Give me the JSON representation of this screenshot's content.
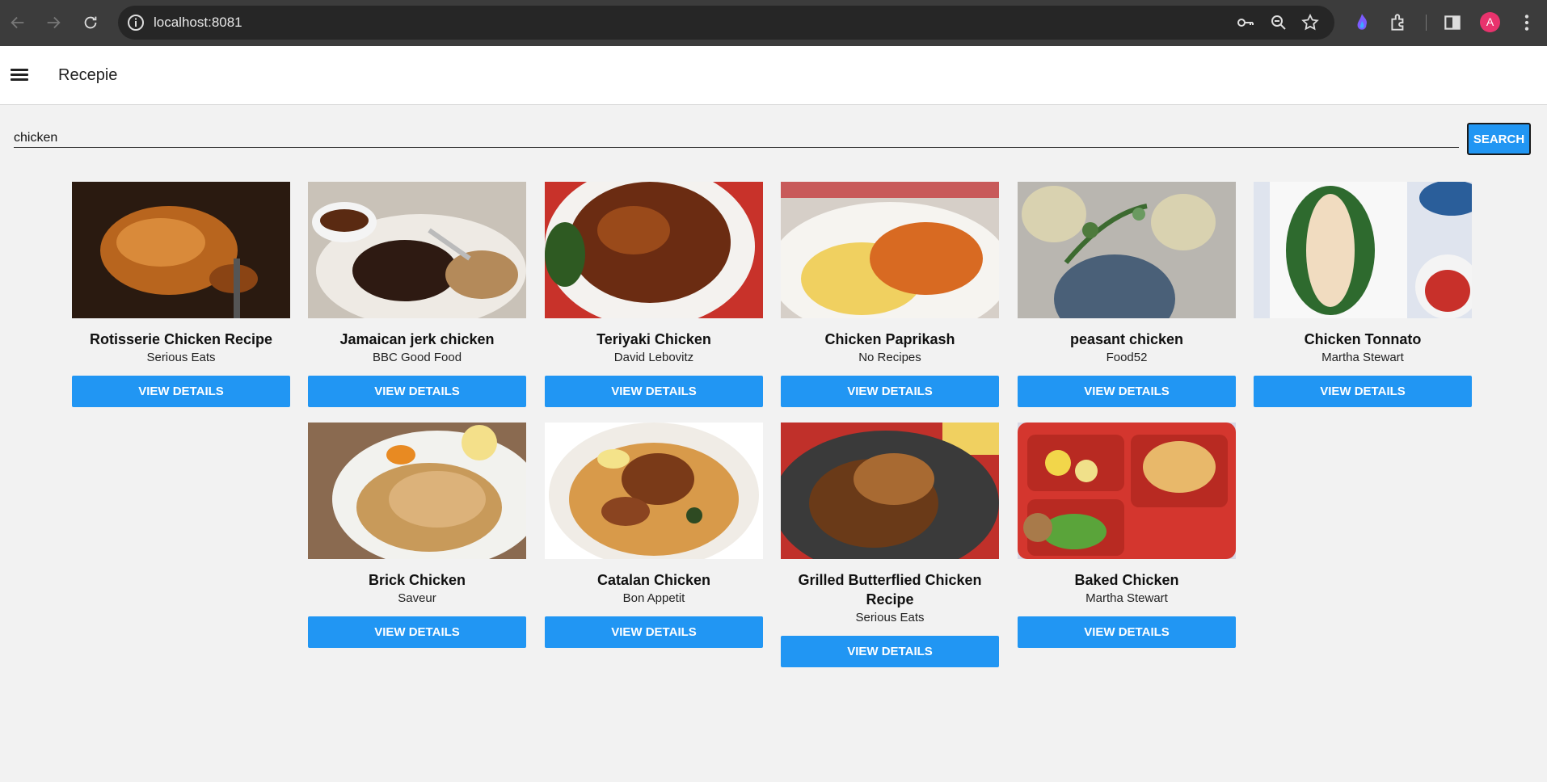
{
  "browser": {
    "url": "localhost:8081",
    "profile_initial": "A",
    "icons": [
      "back-icon",
      "forward-icon",
      "reload-icon",
      "site-info-icon",
      "password-key-icon",
      "zoom-icon",
      "bookmark-star-icon",
      "extension-icon",
      "puzzle-extensions-icon",
      "side-panel-icon",
      "more-menu-icon"
    ]
  },
  "app": {
    "title": "Recepie",
    "menu_icon": "hamburger-menu-icon"
  },
  "search": {
    "value": "chicken",
    "button_label": "SEARCH"
  },
  "recipes": [
    {
      "title": "Rotisserie Chicken Recipe",
      "source": "Serious Eats",
      "button": "VIEW DETAILS"
    },
    {
      "title": "Jamaican jerk chicken",
      "source": "BBC Good Food",
      "button": "VIEW DETAILS"
    },
    {
      "title": "Teriyaki Chicken",
      "source": "David Lebovitz",
      "button": "VIEW DETAILS"
    },
    {
      "title": "Chicken Paprikash",
      "source": "No Recipes",
      "button": "VIEW DETAILS"
    },
    {
      "title": "peasant chicken",
      "source": "Food52",
      "button": "VIEW DETAILS"
    },
    {
      "title": "Chicken Tonnato",
      "source": "Martha Stewart",
      "button": "VIEW DETAILS"
    },
    {
      "title": "Brick Chicken",
      "source": "Saveur",
      "button": "VIEW DETAILS"
    },
    {
      "title": "Catalan Chicken",
      "source": "Bon Appetit",
      "button": "VIEW DETAILS"
    },
    {
      "title": "Grilled Butterflied Chicken Recipe",
      "source": "Serious Eats",
      "button": "VIEW DETAILS"
    },
    {
      "title": "Baked Chicken",
      "source": "Martha Stewart",
      "button": "VIEW DETAILS"
    }
  ],
  "colors": {
    "primary": "#2196f3",
    "background": "#f2f2f2",
    "chrome": "#3c3c3c"
  }
}
